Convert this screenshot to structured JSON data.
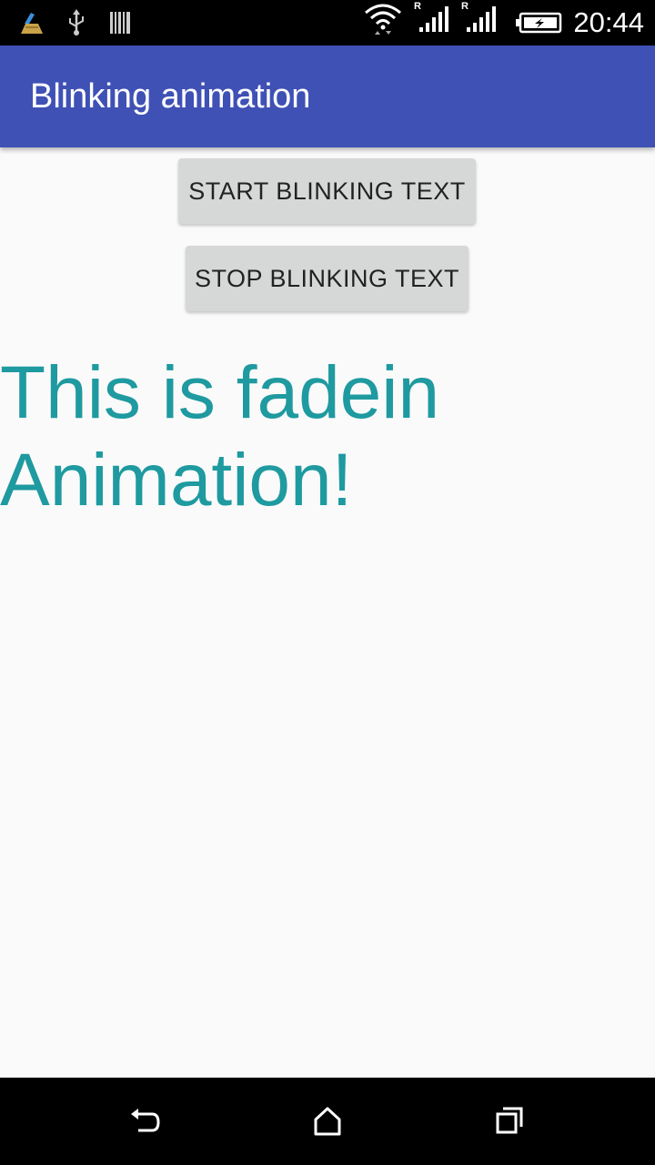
{
  "status_bar": {
    "time": "20:44",
    "icons": [
      "cleaner-app-icon",
      "usb-icon",
      "barcode-icon",
      "wifi-icon",
      "signal-icon",
      "signal-icon",
      "battery-charging-icon"
    ],
    "roaming_marker": "R"
  },
  "app_bar": {
    "title": "Blinking animation",
    "color": "#3f51b5"
  },
  "buttons": {
    "start_label": "START BLINKING TEXT",
    "stop_label": "STOP BLINKING TEXT"
  },
  "main": {
    "fade_text": "This is fadein Animation!",
    "fade_text_color": "#1e9aa0"
  },
  "nav_bar": {
    "icons": [
      "back-icon",
      "home-icon",
      "recents-icon"
    ]
  }
}
